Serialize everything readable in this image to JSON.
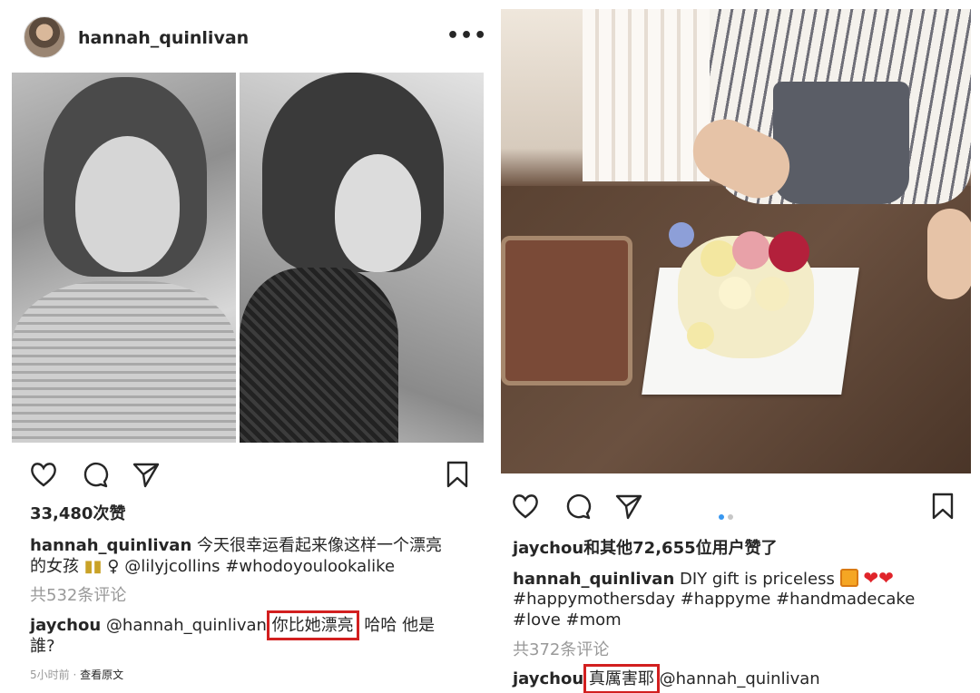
{
  "left_post": {
    "username": "hannah_quinlivan",
    "more": "•••",
    "likes": "33,480次赞",
    "caption_user": "hannah_quinlivan",
    "caption_line1": "今天很幸运看起来像这样一个漂亮",
    "caption_line2_a": "的女孩",
    "caption_line2_b": "♀",
    "caption_line2_c": "@lilyjcollins #whodoyoulookalike",
    "comments_count": "共532条评论",
    "comment_user": "jaychou",
    "comment_mention": "@hannah_quinlivan",
    "comment_highlight": "你比她漂亮",
    "comment_rest": "哈哈 他是",
    "comment_line2": "誰?",
    "time": "5小时前",
    "see_original": "查看原文"
  },
  "right_post": {
    "likes": "jaychou和其他72,655位用户赞了",
    "caption_user": "hannah_quinlivan",
    "caption_text": "DIY gift is priceless",
    "hashtags_line1": "#happymothersday #happyme #handmadecake",
    "hashtags_line2": "#love #mom",
    "comments_count": "共372条评论",
    "comment_user": "jaychou",
    "comment_highlight": "真厲害耶",
    "comment_mention": "@hannah_quinlivan",
    "carousel_index": 1,
    "carousel_total": 2
  },
  "colors": {
    "highlight": "#d21f1f",
    "link": "#003569",
    "muted": "#999999"
  }
}
